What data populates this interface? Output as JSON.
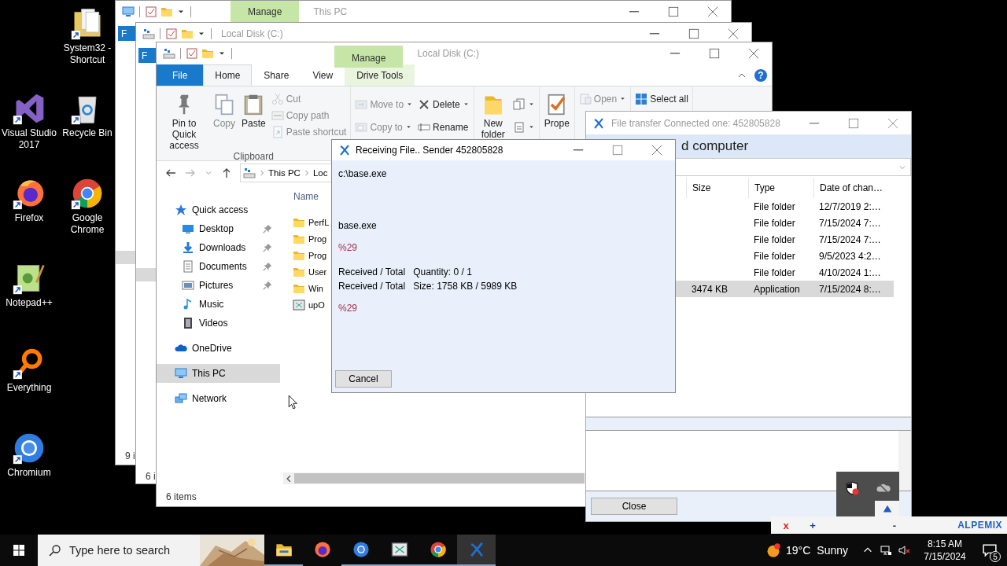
{
  "desktop_icons": [
    {
      "label": "Visual Studio 2017",
      "kind": "vs"
    },
    {
      "label": "Firefox",
      "kind": "firefox"
    },
    {
      "label": "Notepad++",
      "kind": "notepad"
    },
    {
      "label": "Everything",
      "kind": "everything"
    },
    {
      "label": "Chromium",
      "kind": "chromium"
    },
    {
      "label": "System32 - Shortcut",
      "kind": "sys32"
    },
    {
      "label": "Recycle Bin",
      "kind": "recycle"
    },
    {
      "label": "Google Chrome",
      "kind": "chrome"
    }
  ],
  "back_windows": [
    {
      "title": "This PC",
      "context_tab": "Manage",
      "file_tab": "F",
      "status": "9 i",
      "kind": "thispc"
    },
    {
      "title": "Local Disk (C:)",
      "file_tab": "F",
      "status": "6 i",
      "kind": "drive"
    }
  ],
  "explorer": {
    "title": "Local Disk (C:)",
    "context_tab": "Manage",
    "help": "?",
    "tabs": [
      {
        "label": "File",
        "kind": "file",
        "selected": false
      },
      {
        "label": "Home",
        "kind": "tab",
        "selected": true
      },
      {
        "label": "Share",
        "kind": "tab",
        "selected": false
      },
      {
        "label": "View",
        "kind": "tab",
        "selected": false
      },
      {
        "label": "Drive Tools",
        "kind": "tab",
        "selected": false
      }
    ],
    "ribbon": [
      {
        "label": "Clipboard",
        "buttons": [
          {
            "kind": "pin",
            "label": "Pin to Quick access",
            "disabled": false
          },
          {
            "kind": "copy",
            "label": "Copy",
            "disabled": true
          },
          {
            "kind": "paste",
            "label": "Paste",
            "disabled": false
          }
        ],
        "stacks": [
          [
            {
              "kind": "cut",
              "label": "Cut",
              "disabled": true,
              "dropdown": false
            },
            {
              "kind": "copypath",
              "label": "Copy path",
              "disabled": true,
              "dropdown": false
            },
            {
              "kind": "shortcut",
              "label": "Paste shortcut",
              "disabled": true,
              "dropdown": false
            }
          ]
        ]
      },
      {
        "stacks": [
          [
            {
              "kind": "moveto",
              "label": "Move to",
              "disabled": true,
              "dropdown": true
            },
            {
              "kind": "copyto",
              "label": "Copy to",
              "disabled": true,
              "dropdown": true
            }
          ],
          [
            {
              "kind": "delete",
              "label": "Delete",
              "disabled": false,
              "dropdown": true
            },
            {
              "kind": "rename",
              "label": "Rename",
              "disabled": false,
              "dropdown": false
            }
          ]
        ]
      },
      {
        "buttons": [
          {
            "kind": "newfolder",
            "label": "New folder",
            "disabled": false
          }
        ],
        "stacks": [
          [
            {
              "kind": "newitem",
              "disabled": false,
              "dropdown": true
            },
            {
              "kind": "easyaccess",
              "disabled": false,
              "dropdown": true
            }
          ]
        ]
      },
      {
        "buttons": [
          {
            "kind": "properties",
            "label": "Prope",
            "disabled": false
          }
        ]
      },
      {
        "stacks": [
          [
            {
              "kind": "open",
              "label": "Open",
              "disabled": true,
              "dropdown": true
            }
          ]
        ]
      },
      {
        "stacks": [
          [
            {
              "kind": "selectall",
              "label": "Select all",
              "disabled": false,
              "dropdown": false
            }
          ]
        ]
      }
    ],
    "address": [
      "This PC",
      "Loc"
    ],
    "nav": [
      {
        "label": "Quick access",
        "kind": "star",
        "selected": false,
        "children": [
          {
            "label": "Desktop",
            "kind": "desktop",
            "pinned": true,
            "selected": false
          },
          {
            "label": "Downloads",
            "kind": "downloads",
            "pinned": true,
            "selected": false
          },
          {
            "label": "Documents",
            "kind": "documents",
            "pinned": true,
            "selected": false
          },
          {
            "label": "Pictures",
            "kind": "pictures",
            "pinned": true,
            "selected": false
          },
          {
            "label": "Music",
            "kind": "music",
            "pinned": false,
            "selected": false
          },
          {
            "label": "Videos",
            "kind": "videos",
            "pinned": false,
            "selected": false
          }
        ]
      },
      {
        "label": "OneDrive",
        "kind": "onedrive",
        "selected": false
      },
      {
        "label": "This PC",
        "kind": "thispc",
        "selected": true
      },
      {
        "label": "Network",
        "kind": "network",
        "selected": false
      }
    ],
    "list_header": "Name",
    "files": [
      {
        "name": "PerfL",
        "kind": "folder"
      },
      {
        "name": "Prog",
        "kind": "folder"
      },
      {
        "name": "Prog",
        "kind": "folder"
      },
      {
        "name": "User",
        "kind": "folder"
      },
      {
        "name": "Win",
        "kind": "folder"
      },
      {
        "name": "upO",
        "kind": "app"
      }
    ],
    "status": "6 items"
  },
  "transfer_window": {
    "title": "File transfer Connected one: 452805828",
    "heading": "d computer",
    "columns": [
      "Size",
      "Type",
      "Date of chan…"
    ],
    "rows": [
      {
        "type": "File folder",
        "date": "12/7/2019 2:…",
        "selected": false
      },
      {
        "type": "File folder",
        "date": "7/15/2024 7:…",
        "selected": false
      },
      {
        "type": "File folder",
        "date": "7/15/2024 7:…",
        "selected": false
      },
      {
        "type": "File folder",
        "date": "9/5/2023 4:2…",
        "selected": false
      },
      {
        "type": "File folder",
        "date": "4/10/2024 1:…",
        "selected": false
      },
      {
        "size": "3474 KB",
        "type": "Application",
        "date": "7/15/2024 8:…",
        "selected": true
      }
    ],
    "close_button": "Close"
  },
  "dialog": {
    "title": "Receiving File.. Sender 452805828",
    "path": "c:\\base.exe",
    "file": "base.exe",
    "percent": "%29",
    "lines": [
      {
        "label": "Received / Total",
        "value": "Quantity: 0 / 1"
      },
      {
        "label": "Received / Total",
        "value": "Size: 1758 KB / 5989 KB"
      }
    ],
    "percent_total": "%29",
    "cancel_button": "Cancel"
  },
  "taskbar": {
    "search_placeholder": "Type here to search",
    "apps": [
      {
        "kind": "explorer",
        "running": true,
        "active": false
      },
      {
        "kind": "firefox",
        "running": false,
        "active": false
      },
      {
        "kind": "chromium",
        "running": true,
        "active": false
      },
      {
        "kind": "app",
        "running": true,
        "active": false
      },
      {
        "kind": "chrome",
        "running": true,
        "active": false
      },
      {
        "kind": "transfer",
        "running": true,
        "active": true
      }
    ],
    "temperature": "19°C",
    "weather": "Sunny",
    "time": "8:15 AM",
    "date": "7/15/2024",
    "notifications": "5"
  },
  "remote_bar": {
    "buttons": [
      "x",
      "+",
      "-"
    ],
    "brand": "ALPEMIX"
  }
}
